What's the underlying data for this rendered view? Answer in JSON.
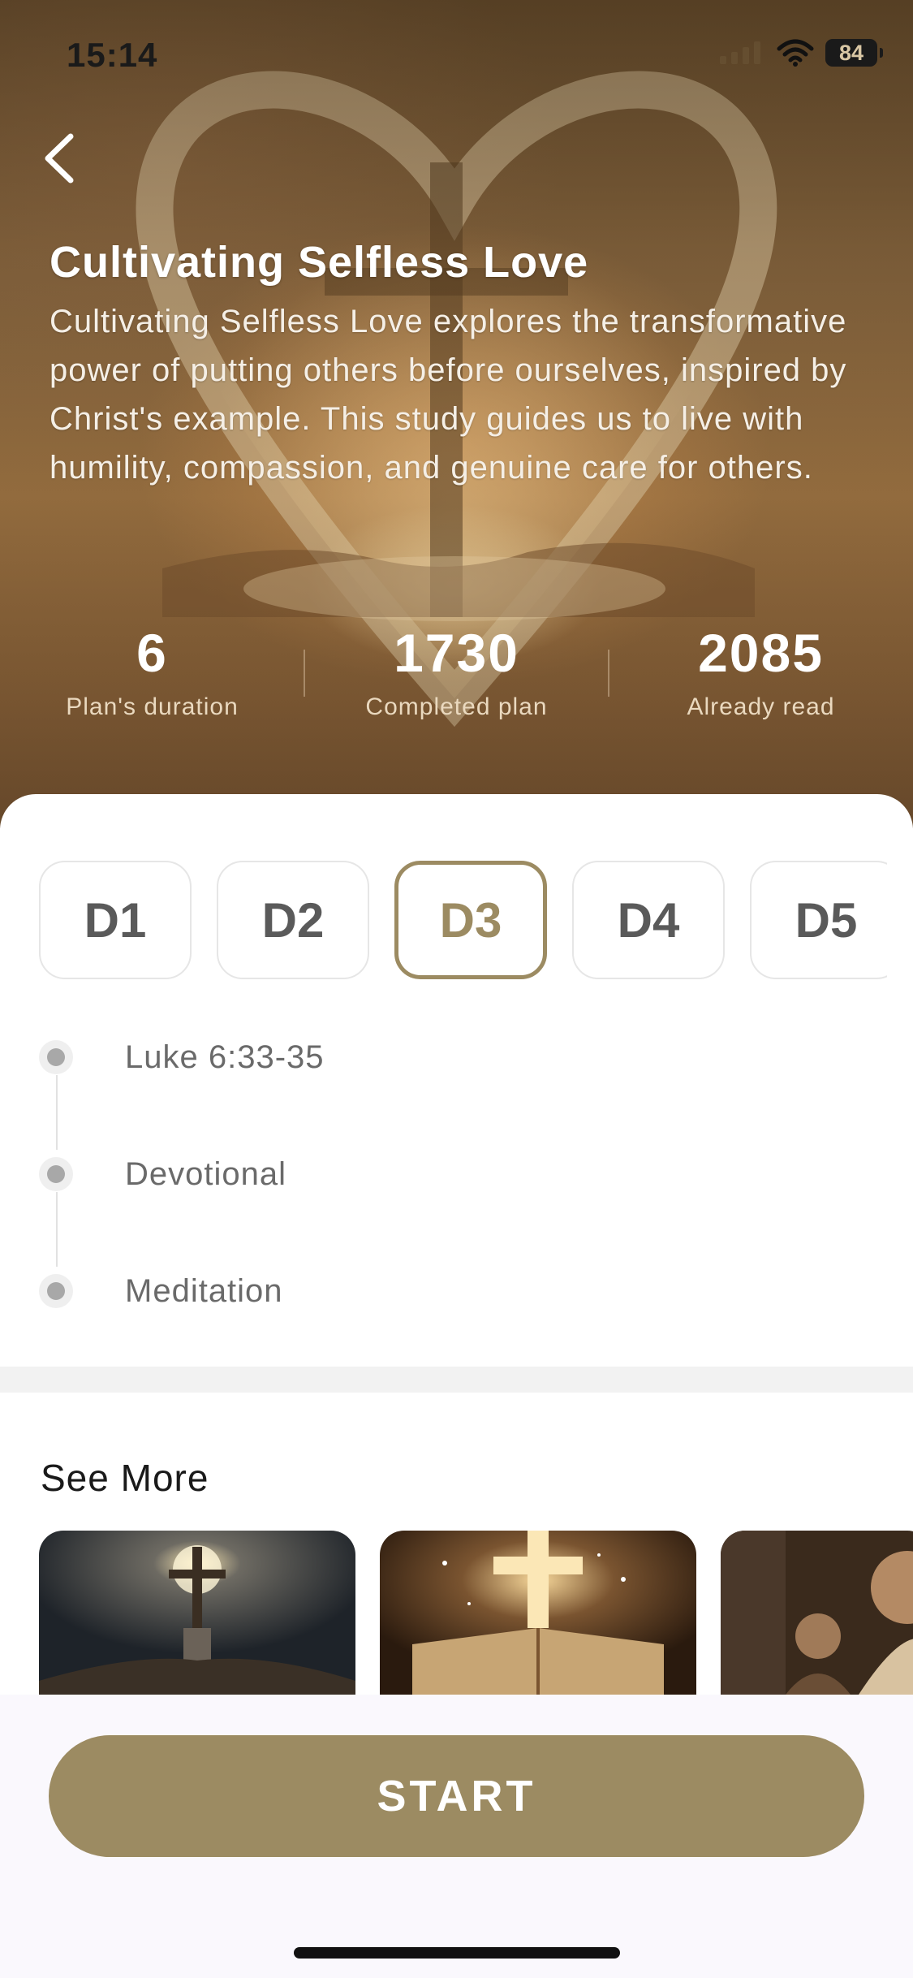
{
  "status_bar": {
    "time": "15:14",
    "battery": "84"
  },
  "hero": {
    "title": "Cultivating Selfless Love",
    "description": "Cultivating Selfless Love explores the transformative power of putting others before ourselves, inspired by Christ's example. This study guides us to live with humility, compassion, and genuine care for others.",
    "stats": [
      {
        "value": "6",
        "label": "Plan's duration"
      },
      {
        "value": "1730",
        "label": "Completed plan"
      },
      {
        "value": "2085",
        "label": "Already read"
      }
    ]
  },
  "days": {
    "tabs": [
      "D1",
      "D2",
      "D3",
      "D4",
      "D5"
    ],
    "selected": "D3"
  },
  "timeline": {
    "items": [
      "Luke 6:33-35",
      "Devotional",
      "Meditation"
    ]
  },
  "see_more": {
    "title": "See More"
  },
  "start_button": {
    "label": "START"
  },
  "colors": {
    "accent": "#9c8b62",
    "tab_text": "#5a5a5a",
    "timeline_text": "#6a6a6a"
  }
}
